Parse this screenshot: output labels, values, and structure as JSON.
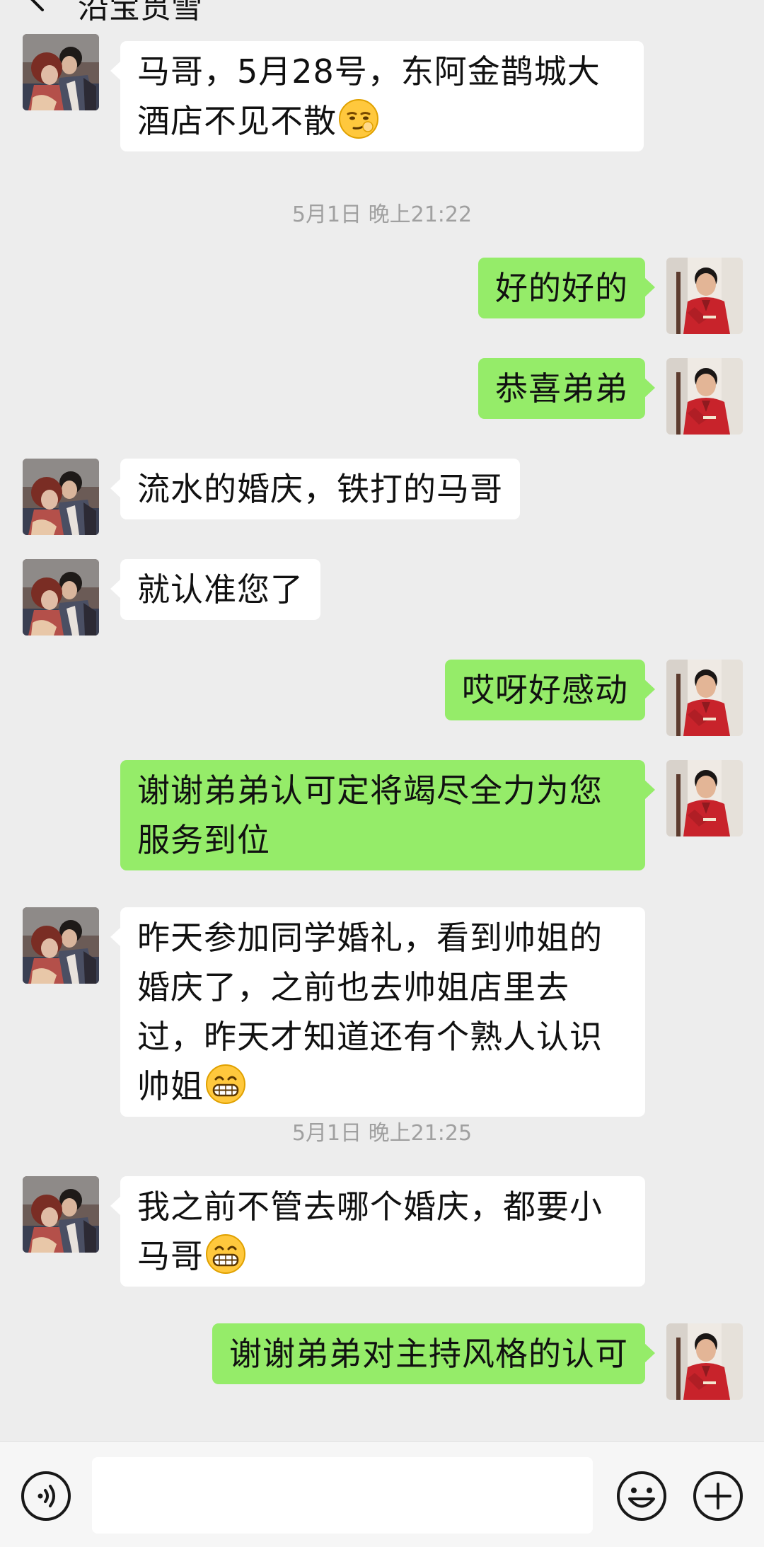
{
  "header": {
    "title": "沿宝贯雪"
  },
  "timestamps": [
    "5月1日 晚上21:22",
    "5月1日 晚上21:25"
  ],
  "messages": [
    {
      "side": "in",
      "text": "马哥，5月28号，东阿金鹊城大酒店不见不散",
      "emoji": "smirk-emoji"
    },
    {
      "side": "out",
      "text": "好的好的"
    },
    {
      "side": "out",
      "text": "恭喜弟弟"
    },
    {
      "side": "in",
      "text": "流水的婚庆，铁打的马哥"
    },
    {
      "side": "in",
      "text": "就认准您了"
    },
    {
      "side": "out",
      "text": "哎呀好感动"
    },
    {
      "side": "out",
      "text": "谢谢弟弟认可定将竭尽全力为您服务到位"
    },
    {
      "side": "in",
      "text": "昨天参加同学婚礼，看到帅姐的婚庆了，之前也去帅姐店里去过，昨天才知道还有个熟人认识帅姐",
      "emoji": "grin-emoji"
    },
    {
      "side": "in",
      "text": "我之前不管去哪个婚庆，都要小马哥",
      "emoji": "grin-emoji"
    },
    {
      "side": "out",
      "text": "谢谢弟弟对主持风格的认可"
    }
  ],
  "colors": {
    "background": "#ededed",
    "incoming_bubble": "#ffffff",
    "outgoing_bubble": "#95ec69",
    "timestamp": "#a0a0a0"
  },
  "input_bar": {
    "left_icon": "voice-icon",
    "right_icons": [
      "emoji-icon",
      "plus-icon"
    ],
    "placeholder": ""
  }
}
